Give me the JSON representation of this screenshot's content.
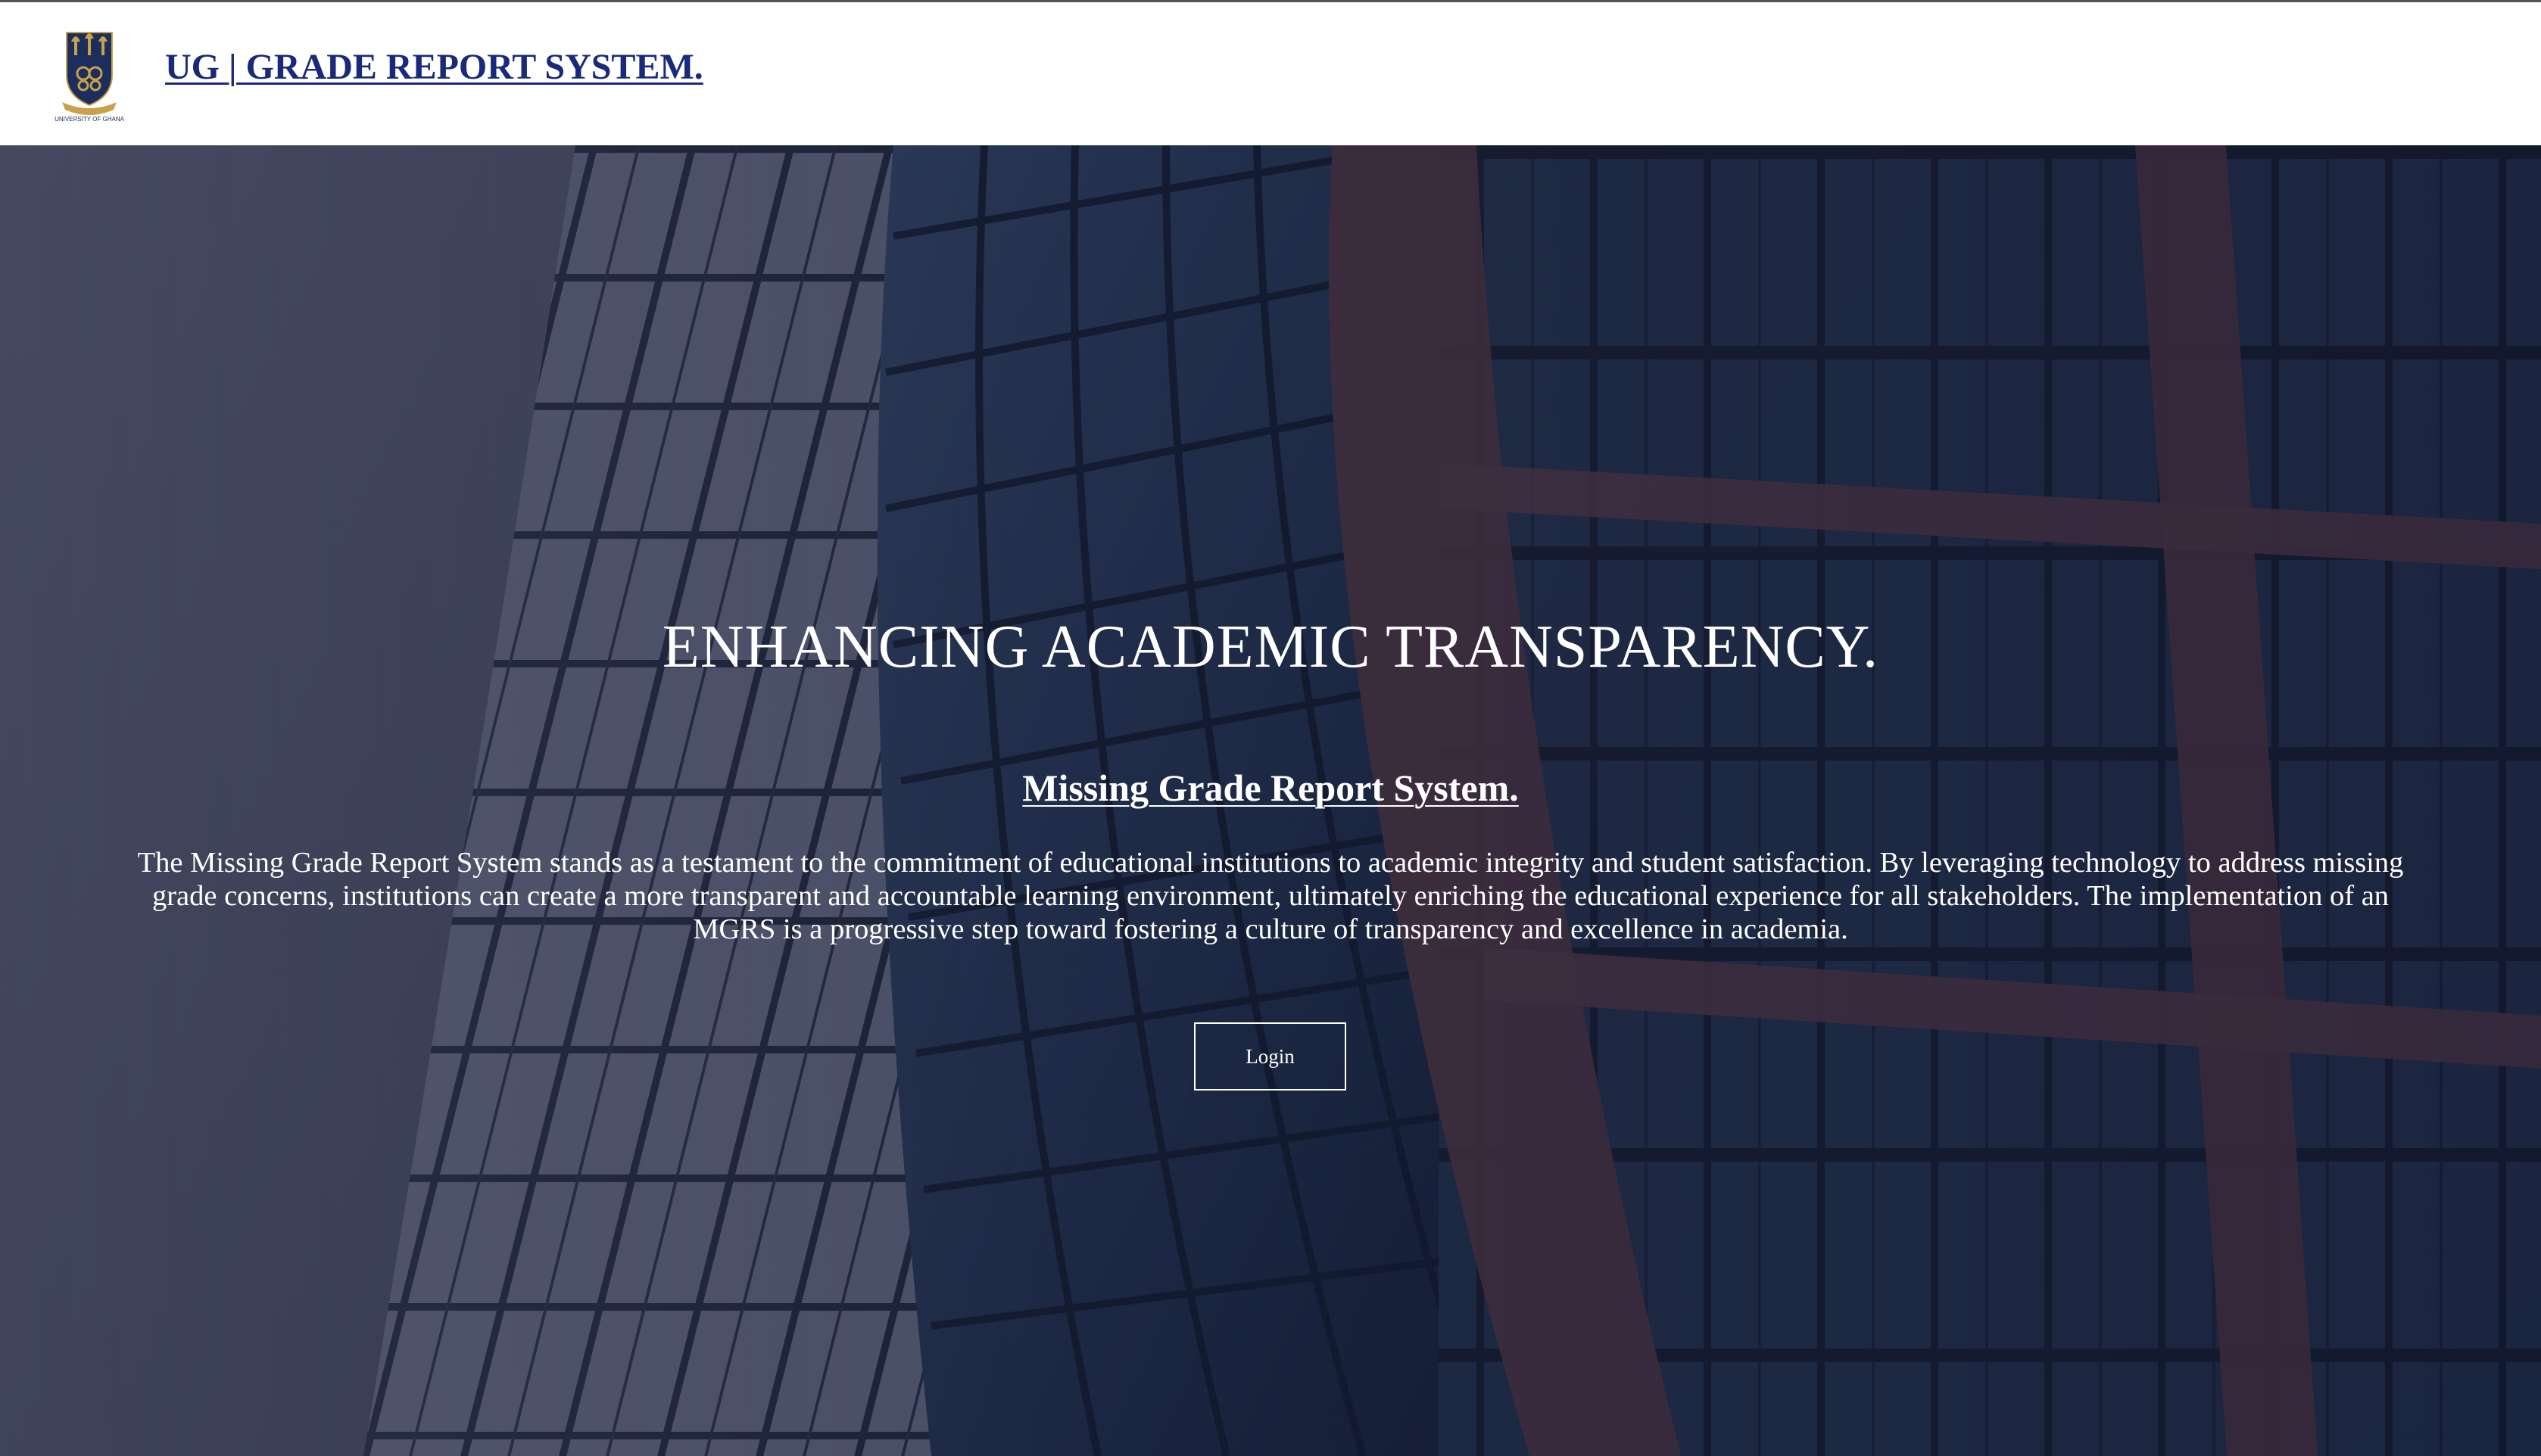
{
  "header": {
    "logo_icon": "university-of-ghana-crest-icon",
    "logo_caption": "UNIVERSITY OF GHANA",
    "brand_title": "UG | GRADE REPORT SYSTEM."
  },
  "hero": {
    "background_icon": "building-facade-photo",
    "title": "ENHANCING ACADEMIC TRANSPARENCY.",
    "subtitle": "Missing Grade Report System.",
    "description": "The Missing Grade Report System stands as a testament to the commitment of educational institutions to academic integrity and student satisfaction. By leveraging technology to address missing grade concerns, institutions can create a more transparent and accountable learning environment, ultimately enriching the educational experience for all stakeholders. The implementation of an MGRS is a progressive step toward fostering a culture of transparency and excellence in academia.",
    "login_label": "Login"
  },
  "colors": {
    "brand_text": "#1a2a7a",
    "hero_text": "#ffffff",
    "crest_blue": "#1b2e5c",
    "crest_gold": "#c9a14a"
  }
}
